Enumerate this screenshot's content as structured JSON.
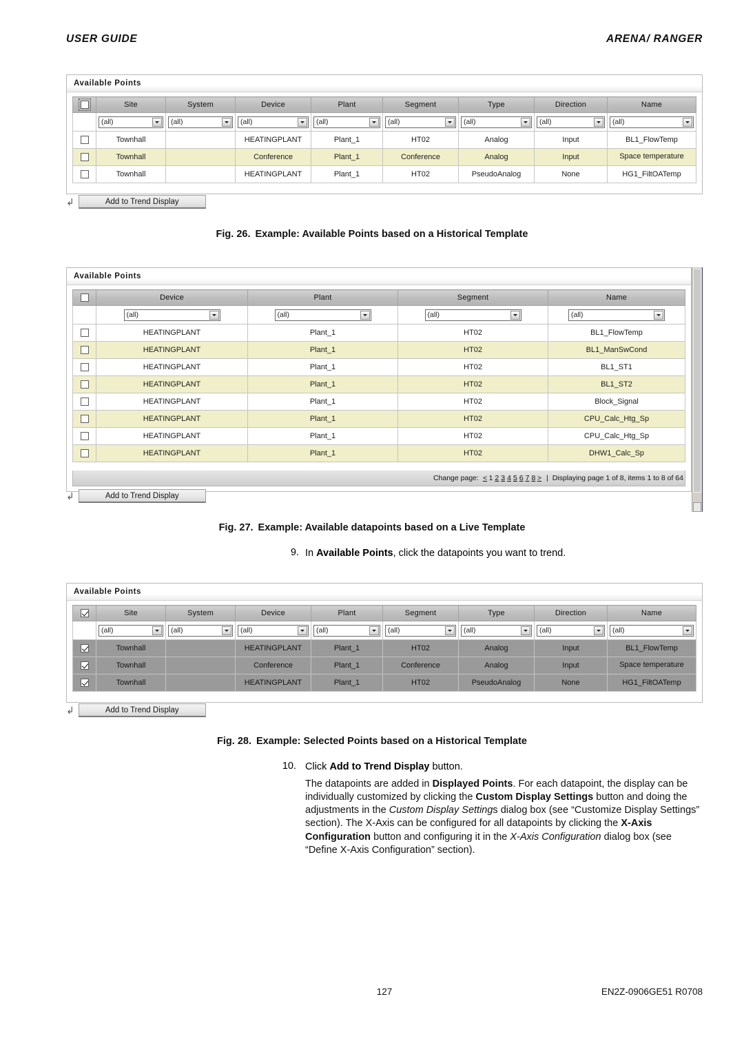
{
  "header": {
    "left": "USER GUIDE",
    "right": "ARENA/ RANGER"
  },
  "footer": {
    "page_number": "127",
    "doc_id": "EN2Z-0906GE51 R0708"
  },
  "panel_title": "Available Points",
  "button_label": "Add to Trend Display",
  "filter_value": "(all)",
  "colors": {
    "highlight_row": "#f0efc9",
    "selected_row": "#9a9a9a",
    "header_grey": "#bdbdbd"
  },
  "fig26": {
    "panel_title": "Available Points",
    "columns": [
      "Site",
      "System",
      "Device",
      "Plant",
      "Segment",
      "Type",
      "Direction",
      "Name"
    ],
    "filters": [
      "(all)",
      "(all)",
      "(all)",
      "(all)",
      "(all)",
      "(all)",
      "(all)",
      "(all)"
    ],
    "header_checkbox": "unchecked",
    "rows": [
      {
        "checked": false,
        "highlight": false,
        "cells": [
          "Townhall",
          "",
          "HEATINGPLANT",
          "Plant_1",
          "HT02",
          "Analog",
          "Input",
          "BL1_FlowTemp"
        ]
      },
      {
        "checked": false,
        "highlight": true,
        "cells": [
          "Townhall",
          "",
          "Conference",
          "Plant_1",
          "Conference",
          "Analog",
          "Input",
          "Space temperature"
        ]
      },
      {
        "checked": false,
        "highlight": false,
        "cells": [
          "Townhall",
          "",
          "HEATINGPLANT",
          "Plant_1",
          "HT02",
          "PseudoAnalog",
          "None",
          "HG1_FiltOATemp"
        ]
      }
    ],
    "button_label": "Add to Trend Display",
    "caption_num": "Fig. 26.",
    "caption_text": "Example: Available Points based on a Historical Template"
  },
  "fig27": {
    "panel_title": "Available Points",
    "columns": [
      "Device",
      "Plant",
      "Segment",
      "Name"
    ],
    "filters": [
      "(all)",
      "(all)",
      "(all)",
      "(all)"
    ],
    "header_checkbox": "unchecked",
    "rows": [
      {
        "checked": false,
        "highlight": false,
        "cells": [
          "HEATINGPLANT",
          "Plant_1",
          "HT02",
          "BL1_FlowTemp"
        ]
      },
      {
        "checked": false,
        "highlight": true,
        "cells": [
          "HEATINGPLANT",
          "Plant_1",
          "HT02",
          "BL1_ManSwCond"
        ]
      },
      {
        "checked": false,
        "highlight": false,
        "cells": [
          "HEATINGPLANT",
          "Plant_1",
          "HT02",
          "BL1_ST1"
        ]
      },
      {
        "checked": false,
        "highlight": true,
        "cells": [
          "HEATINGPLANT",
          "Plant_1",
          "HT02",
          "BL1_ST2"
        ]
      },
      {
        "checked": false,
        "highlight": false,
        "cells": [
          "HEATINGPLANT",
          "Plant_1",
          "HT02",
          "Block_Signal"
        ]
      },
      {
        "checked": false,
        "highlight": true,
        "cells": [
          "HEATINGPLANT",
          "Plant_1",
          "HT02",
          "CPU_Calc_Htg_Sp"
        ]
      },
      {
        "checked": false,
        "highlight": false,
        "cells": [
          "HEATINGPLANT",
          "Plant_1",
          "HT02",
          "CPU_Calc_Htg_Sp"
        ]
      },
      {
        "checked": false,
        "highlight": true,
        "cells": [
          "HEATINGPLANT",
          "Plant_1",
          "HT02",
          "DHW1_Calc_Sp"
        ]
      }
    ],
    "pager": {
      "label": "Change page:",
      "prev": "<",
      "pages": [
        "1",
        "2",
        "3",
        "4",
        "5",
        "6",
        "7",
        "8"
      ],
      "current_page": "1",
      "next": ">",
      "separator": "|",
      "status": "Displaying page 1 of 8, items 1 to 8 of 64"
    },
    "button_label": "Add to Trend Display",
    "caption_num": "Fig. 27.",
    "caption_text": "Example: Available datapoints based on a Live Template"
  },
  "fig28": {
    "panel_title": "Available Points",
    "columns": [
      "Site",
      "System",
      "Device",
      "Plant",
      "Segment",
      "Type",
      "Direction",
      "Name"
    ],
    "filters": [
      "(all)",
      "(all)",
      "(all)",
      "(all)",
      "(all)",
      "(all)",
      "(all)",
      "(all)"
    ],
    "header_checkbox": "checked",
    "rows": [
      {
        "checked": true,
        "selected": true,
        "cells": [
          "Townhall",
          "",
          "HEATINGPLANT",
          "Plant_1",
          "HT02",
          "Analog",
          "Input",
          "BL1_FlowTemp"
        ]
      },
      {
        "checked": true,
        "selected": true,
        "cells": [
          "Townhall",
          "",
          "Conference",
          "Plant_1",
          "Conference",
          "Analog",
          "Input",
          "Space temperature"
        ]
      },
      {
        "checked": true,
        "selected": true,
        "cells": [
          "Townhall",
          "",
          "HEATINGPLANT",
          "Plant_1",
          "HT02",
          "PseudoAnalog",
          "None",
          "HG1_FiltOATemp"
        ]
      }
    ],
    "button_label": "Add to Trend Display",
    "caption_num": "Fig. 28.",
    "caption_text": "Example: Selected Points based on a Historical Template"
  },
  "steps": {
    "step9_num": "9.",
    "step9_text_a": "In ",
    "step9_bold": "Available Points",
    "step9_text_b": ", click the datapoints you want to trend.",
    "step10_num": "10.",
    "step10_text_a": "Click ",
    "step10_bold": "Add to Trend Display",
    "step10_text_b": " button.",
    "para_1a": "The datapoints are added in ",
    "para_1b": "Displayed Points",
    "para_1c": ". For each datapoint, the display can be individually customized by clicking the ",
    "para_1d": "Custom Display Settings",
    "para_1e": " button and doing the adjustments in the ",
    "para_1f": "Custom Display Setting",
    "para_1g": "s dialog box (see “Customize Display Settings” section). The X-Axis can be configured for all datapoints by clicking the ",
    "para_1h": "X-Axis Configuration",
    "para_1i": " button and configuring it in the ",
    "para_1j": "X-Axis Configuration",
    "para_1k": " dialog box (see “Define X-Axis Configuration” section)."
  }
}
